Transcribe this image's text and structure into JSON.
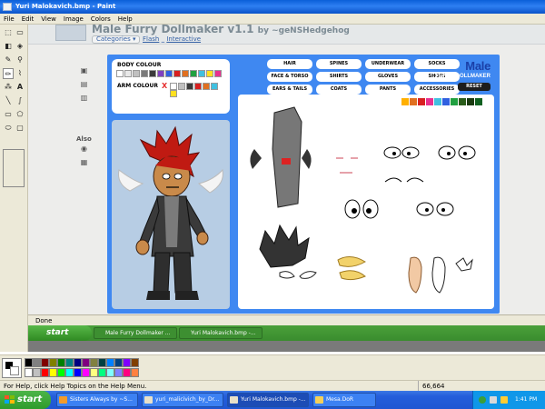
{
  "window": {
    "title": "Yuri Malokavich.bmp - Paint"
  },
  "menu": [
    "File",
    "Edit",
    "View",
    "Image",
    "Colors",
    "Help"
  ],
  "page": {
    "game_title": "Male Furry Dollmaker v1.1",
    "byline": "by ~geNSHedgehog",
    "categories_label": "Categories",
    "breadcrumb_a": "Flash",
    "breadcrumb_sep": "_",
    "breadcrumb_b": "Interactive",
    "also_label": "Also"
  },
  "game": {
    "body_colour_label": "BODY COLOUR",
    "arm_colour_label": "ARM COLOUR",
    "arm_x": "X",
    "body_colors": [
      "#ffffff",
      "#e8e8e8",
      "#c0c0c0",
      "#7a7a7a",
      "#3b3b3b",
      "#8040c0",
      "#3060e0",
      "#d82020",
      "#e07020",
      "#20a040",
      "#40c0e0",
      "#ffe020",
      "#e83090"
    ],
    "arm_colors": [
      "#ffffff",
      "#c0c0c0",
      "#3b3b3b",
      "#d82020",
      "#e07020",
      "#40c0e0",
      "#ffe020"
    ],
    "categories": [
      "HAIR",
      "SPINES",
      "UNDERWEAR",
      "SOCKS",
      "FACE & TORSO",
      "SHIRTS",
      "GLOVES",
      "SHOES",
      "EARS & TAILS",
      "COATS",
      "PANTS",
      "ACCESSORIES"
    ],
    "brand_main": "Male",
    "brand_sub": "FURRY DOLLMAKER",
    "reset_label": "RESET",
    "item_colors": [
      "#ffb000",
      "#e07020",
      "#d82020",
      "#e83090",
      "#40c0e0",
      "#3060e0",
      "#20a040",
      "#2a5c1a",
      "#1a3a10",
      "#106020"
    ]
  },
  "browser": {
    "status": "Done"
  },
  "inner_taskbar": {
    "start": "start",
    "items": [
      "Male Furry Dollmaker ...",
      "Yuri Malokavich.bmp -..."
    ]
  },
  "paint_status": {
    "help": "For Help, click Help Topics on the Help Menu.",
    "coords": "66,664"
  },
  "palette": [
    "#000000",
    "#808080",
    "#800000",
    "#808000",
    "#008000",
    "#008080",
    "#000080",
    "#800080",
    "#808040",
    "#004040",
    "#0080ff",
    "#004080",
    "#8000ff",
    "#804000",
    "#ffffff",
    "#c0c0c0",
    "#ff0000",
    "#ffff00",
    "#00ff00",
    "#00ffff",
    "#0000ff",
    "#ff00ff",
    "#ffff80",
    "#00ff80",
    "#80ffff",
    "#8080ff",
    "#ff0080",
    "#ff8040"
  ],
  "taskbar": {
    "start": "start",
    "items": [
      "Sisters Always by ~S...",
      "yuri_malicivich_by_Dr...",
      "Yuri Malokavich.bmp -...",
      "Mesa.DoR"
    ],
    "clock": "1:41 PM"
  }
}
